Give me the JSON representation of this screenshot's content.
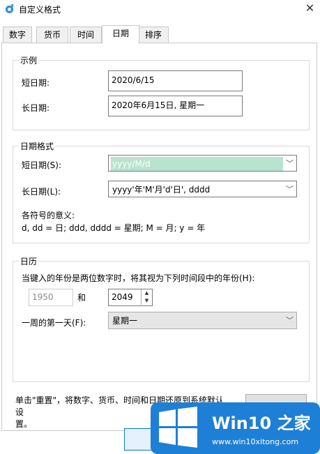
{
  "window": {
    "title": "自定义格式",
    "close_glyph": "✕"
  },
  "tabs": [
    {
      "label": "数字"
    },
    {
      "label": "货币"
    },
    {
      "label": "时间"
    },
    {
      "label": "日期",
      "active": true
    },
    {
      "label": "排序"
    }
  ],
  "example": {
    "group_label": "示例",
    "short_label": "短日期:",
    "short_value": "2020/6/15",
    "long_label": "长日期:",
    "long_value": "2020年6月15日, 星期一"
  },
  "format": {
    "group_label": "日期格式",
    "short_label": "短日期(S):",
    "short_value": "yyyy/M/d",
    "long_label": "长日期(L):",
    "long_value": "yyyy'年'M'月'd'日', dddd",
    "legend_title": "各符号的意义:",
    "legend_text": "d, dd = 日;  ddd, dddd = 星期;  M = 月;  y = 年"
  },
  "calendar": {
    "group_label": "日历",
    "description": "当键入的年份是两位数字时，将其视为下列时间段中的年份(H):",
    "from_year": "1950",
    "and_label": "和",
    "to_year": "2049",
    "first_day_label": "一周的第一天(F):",
    "first_day_value": "星期一"
  },
  "footer": {
    "reset_text_line1": "单击\"重置\"，将数字、货币、时间和日期还原到系统默认设",
    "reset_text_line2": "置。"
  },
  "watermark": {
    "brand": "Win10 之家",
    "url": "www.win10xitong.com"
  },
  "colors": {
    "accent": "#0078d7",
    "selection": "#b7e3cf",
    "watermark_bg": "#1e7fd6"
  }
}
